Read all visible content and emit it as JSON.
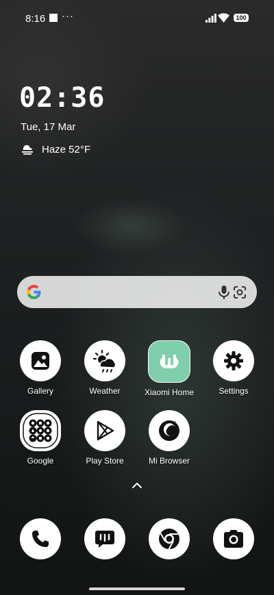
{
  "status_bar": {
    "time": "8:16",
    "more": "···",
    "battery": "100"
  },
  "lock_widget": {
    "clock": "02:36",
    "date": "Tue, 17 Mar",
    "weather": "Haze  52°F",
    "weather_icon": "haze-icon"
  },
  "search_bar": {
    "icons": [
      "google-icon",
      "mic-icon",
      "lens-icon"
    ]
  },
  "apps": [
    {
      "label": "Gallery",
      "icon": "gallery-icon"
    },
    {
      "label": "Weather",
      "icon": "weather-icon"
    },
    {
      "label": "Xiaomi Home",
      "icon": "xiaomi-home-icon"
    },
    {
      "label": "Settings",
      "icon": "gear-icon"
    },
    {
      "label": "Google",
      "icon": "google-folder-icon"
    },
    {
      "label": "Play Store",
      "icon": "play-store-icon"
    },
    {
      "label": "Mi Browser",
      "icon": "mi-browser-icon"
    }
  ],
  "dock": [
    {
      "icon": "phone-icon"
    },
    {
      "icon": "messages-icon"
    },
    {
      "icon": "chrome-icon"
    },
    {
      "icon": "camera-icon"
    }
  ],
  "colors": {
    "xiaomi_home_bg": "#7fcfad",
    "search_bg": "#e9e9e9",
    "icon_bg": "#ffffff"
  }
}
